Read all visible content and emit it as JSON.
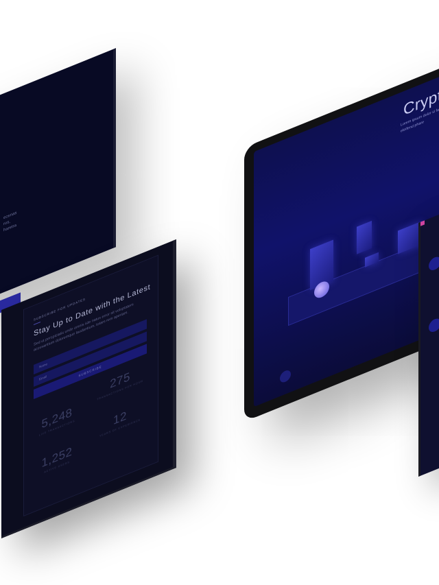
{
  "panel_left_back": {
    "text_lines": [
      "ecenas",
      "ros,",
      "haretra"
    ]
  },
  "subscribe_panel": {
    "eyebrow": "SUBSCRIBE FOR UPDATES",
    "heading": "Stay Up to Date with the Latest",
    "description": "Sed ut perspiciatis unde omnis iste natus error sit voluptatem accusantium doloremque laudantium, totam rem aperiam.",
    "name_placeholder": "Name",
    "email_placeholder": "Email",
    "button_label": "SUBSCRIBE",
    "stats": [
      {
        "value": "5,248",
        "label": "LIVE TRANSACTIONS"
      },
      {
        "value": "275",
        "label": "TRANSACTIONS PER HOUR"
      },
      {
        "value": "1,252",
        "label": "ACTIVE USERS"
      },
      {
        "value": "12",
        "label": "YEARS OF EXPERIENCE"
      }
    ]
  },
  "tablet": {
    "title": "Crypto",
    "body": "Lorem ipsum dolor si facilisis eleifend, ipsum eleifend phare",
    "colors": {
      "accent": "#3b3ce0",
      "background": "#10126a"
    }
  },
  "phone": {
    "accent_color": "#d044a0"
  }
}
